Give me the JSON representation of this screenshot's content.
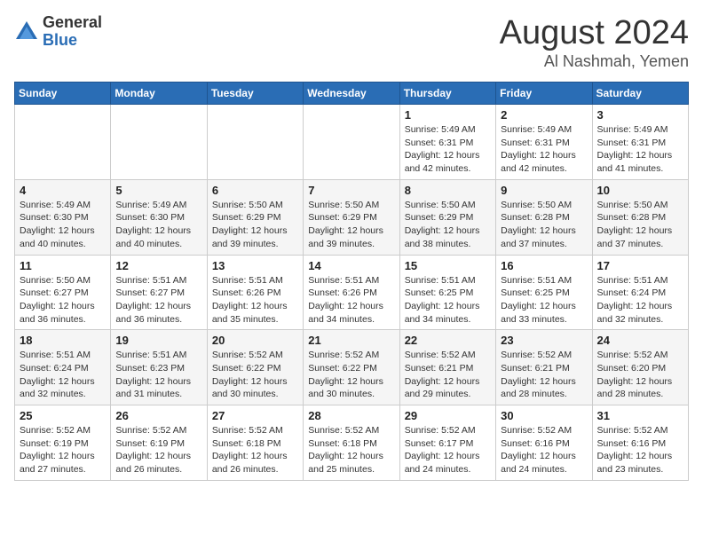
{
  "header": {
    "logo_general": "General",
    "logo_blue": "Blue",
    "month_title": "August 2024",
    "location": "Al Nashmah, Yemen"
  },
  "days_of_week": [
    "Sunday",
    "Monday",
    "Tuesday",
    "Wednesday",
    "Thursday",
    "Friday",
    "Saturday"
  ],
  "weeks": [
    [
      {
        "day": "",
        "content": ""
      },
      {
        "day": "",
        "content": ""
      },
      {
        "day": "",
        "content": ""
      },
      {
        "day": "",
        "content": ""
      },
      {
        "day": "1",
        "content": "Sunrise: 5:49 AM\nSunset: 6:31 PM\nDaylight: 12 hours\nand 42 minutes."
      },
      {
        "day": "2",
        "content": "Sunrise: 5:49 AM\nSunset: 6:31 PM\nDaylight: 12 hours\nand 42 minutes."
      },
      {
        "day": "3",
        "content": "Sunrise: 5:49 AM\nSunset: 6:31 PM\nDaylight: 12 hours\nand 41 minutes."
      }
    ],
    [
      {
        "day": "4",
        "content": "Sunrise: 5:49 AM\nSunset: 6:30 PM\nDaylight: 12 hours\nand 40 minutes."
      },
      {
        "day": "5",
        "content": "Sunrise: 5:49 AM\nSunset: 6:30 PM\nDaylight: 12 hours\nand 40 minutes."
      },
      {
        "day": "6",
        "content": "Sunrise: 5:50 AM\nSunset: 6:29 PM\nDaylight: 12 hours\nand 39 minutes."
      },
      {
        "day": "7",
        "content": "Sunrise: 5:50 AM\nSunset: 6:29 PM\nDaylight: 12 hours\nand 39 minutes."
      },
      {
        "day": "8",
        "content": "Sunrise: 5:50 AM\nSunset: 6:29 PM\nDaylight: 12 hours\nand 38 minutes."
      },
      {
        "day": "9",
        "content": "Sunrise: 5:50 AM\nSunset: 6:28 PM\nDaylight: 12 hours\nand 37 minutes."
      },
      {
        "day": "10",
        "content": "Sunrise: 5:50 AM\nSunset: 6:28 PM\nDaylight: 12 hours\nand 37 minutes."
      }
    ],
    [
      {
        "day": "11",
        "content": "Sunrise: 5:50 AM\nSunset: 6:27 PM\nDaylight: 12 hours\nand 36 minutes."
      },
      {
        "day": "12",
        "content": "Sunrise: 5:51 AM\nSunset: 6:27 PM\nDaylight: 12 hours\nand 36 minutes."
      },
      {
        "day": "13",
        "content": "Sunrise: 5:51 AM\nSunset: 6:26 PM\nDaylight: 12 hours\nand 35 minutes."
      },
      {
        "day": "14",
        "content": "Sunrise: 5:51 AM\nSunset: 6:26 PM\nDaylight: 12 hours\nand 34 minutes."
      },
      {
        "day": "15",
        "content": "Sunrise: 5:51 AM\nSunset: 6:25 PM\nDaylight: 12 hours\nand 34 minutes."
      },
      {
        "day": "16",
        "content": "Sunrise: 5:51 AM\nSunset: 6:25 PM\nDaylight: 12 hours\nand 33 minutes."
      },
      {
        "day": "17",
        "content": "Sunrise: 5:51 AM\nSunset: 6:24 PM\nDaylight: 12 hours\nand 32 minutes."
      }
    ],
    [
      {
        "day": "18",
        "content": "Sunrise: 5:51 AM\nSunset: 6:24 PM\nDaylight: 12 hours\nand 32 minutes."
      },
      {
        "day": "19",
        "content": "Sunrise: 5:51 AM\nSunset: 6:23 PM\nDaylight: 12 hours\nand 31 minutes."
      },
      {
        "day": "20",
        "content": "Sunrise: 5:52 AM\nSunset: 6:22 PM\nDaylight: 12 hours\nand 30 minutes."
      },
      {
        "day": "21",
        "content": "Sunrise: 5:52 AM\nSunset: 6:22 PM\nDaylight: 12 hours\nand 30 minutes."
      },
      {
        "day": "22",
        "content": "Sunrise: 5:52 AM\nSunset: 6:21 PM\nDaylight: 12 hours\nand 29 minutes."
      },
      {
        "day": "23",
        "content": "Sunrise: 5:52 AM\nSunset: 6:21 PM\nDaylight: 12 hours\nand 28 minutes."
      },
      {
        "day": "24",
        "content": "Sunrise: 5:52 AM\nSunset: 6:20 PM\nDaylight: 12 hours\nand 28 minutes."
      }
    ],
    [
      {
        "day": "25",
        "content": "Sunrise: 5:52 AM\nSunset: 6:19 PM\nDaylight: 12 hours\nand 27 minutes."
      },
      {
        "day": "26",
        "content": "Sunrise: 5:52 AM\nSunset: 6:19 PM\nDaylight: 12 hours\nand 26 minutes."
      },
      {
        "day": "27",
        "content": "Sunrise: 5:52 AM\nSunset: 6:18 PM\nDaylight: 12 hours\nand 26 minutes."
      },
      {
        "day": "28",
        "content": "Sunrise: 5:52 AM\nSunset: 6:18 PM\nDaylight: 12 hours\nand 25 minutes."
      },
      {
        "day": "29",
        "content": "Sunrise: 5:52 AM\nSunset: 6:17 PM\nDaylight: 12 hours\nand 24 minutes."
      },
      {
        "day": "30",
        "content": "Sunrise: 5:52 AM\nSunset: 6:16 PM\nDaylight: 12 hours\nand 24 minutes."
      },
      {
        "day": "31",
        "content": "Sunrise: 5:52 AM\nSunset: 6:16 PM\nDaylight: 12 hours\nand 23 minutes."
      }
    ]
  ]
}
